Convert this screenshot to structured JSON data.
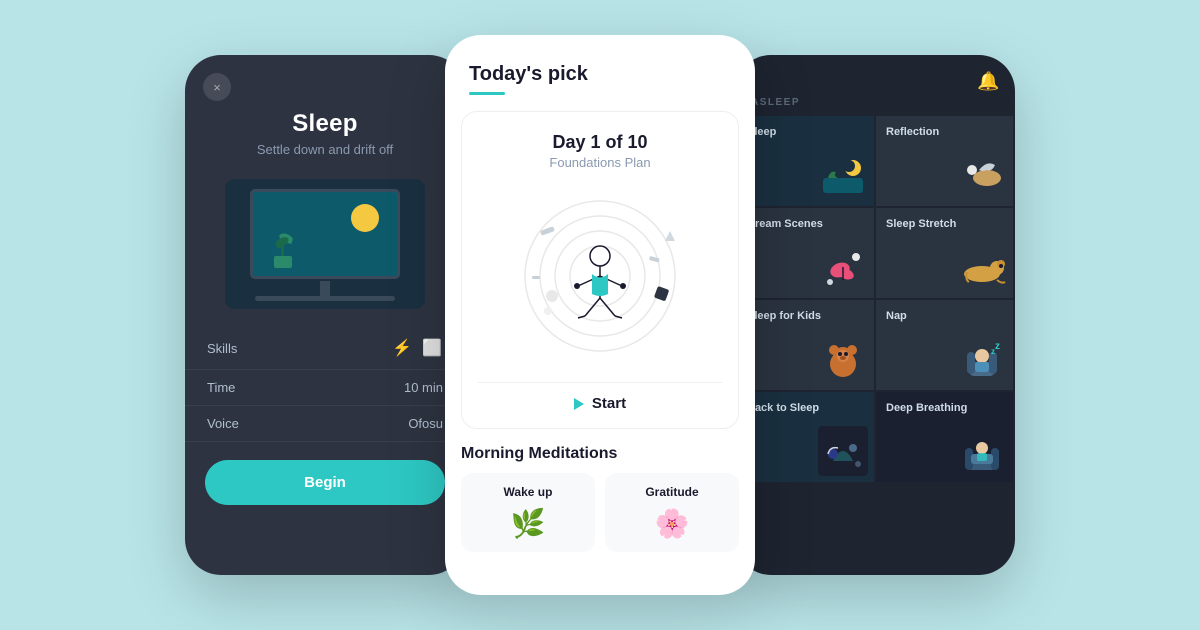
{
  "background": "#b8e4e8",
  "left_phone": {
    "close_label": "×",
    "title": "Sleep",
    "subtitle": "Settle down and drift off",
    "skills_label": "Skills",
    "time_label": "Time",
    "time_value": "10 min",
    "voice_label": "Voice",
    "voice_value": "Ofosu",
    "begin_label": "Begin"
  },
  "center_phone": {
    "header_title": "Today's pick",
    "card_day": "Day 1 of 10",
    "card_plan": "Foundations Plan",
    "start_label": "Start",
    "morning_title": "Morning Meditations",
    "morning_cards": [
      {
        "title": "Wake up",
        "icon": "🌿"
      },
      {
        "title": "Gratitude",
        "icon": "🌸"
      }
    ]
  },
  "right_phone": {
    "section_label": "ASLEEP",
    "cells": [
      {
        "title": "Sleep",
        "color": "#1a3040"
      },
      {
        "title": "Reflection",
        "color": "#2a3340"
      },
      {
        "title": "Dream Scenes",
        "color": "#2a3340"
      },
      {
        "title": "Sleep Stretch",
        "color": "#2a3340"
      },
      {
        "title": "Sleep for Kids",
        "color": "#2a3340"
      },
      {
        "title": "Nap",
        "color": "#2a3340"
      },
      {
        "title": "Back to Sleep",
        "color": "#1a2030"
      },
      {
        "title": "Deep Breathing",
        "color": "#1a2030"
      }
    ]
  }
}
